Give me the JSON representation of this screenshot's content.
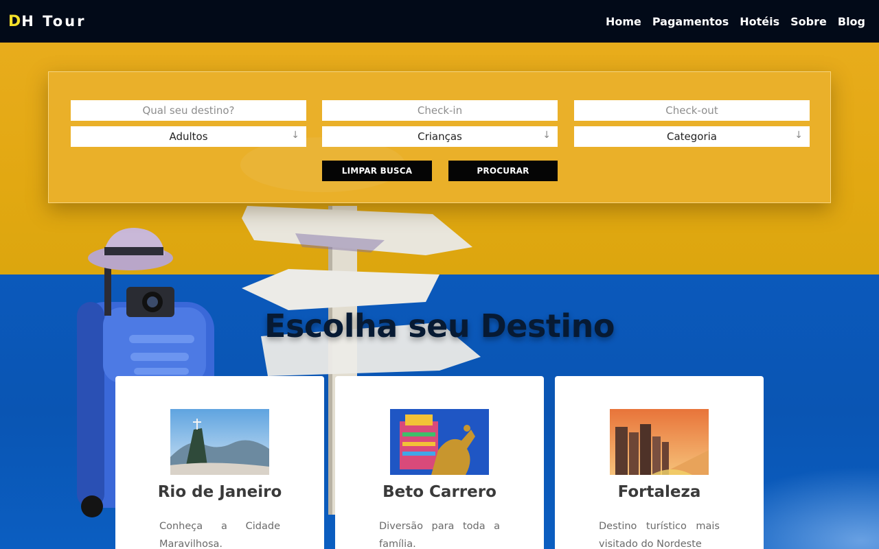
{
  "brand": {
    "logo_initial": "D",
    "logo_rest": "H Tour"
  },
  "nav": {
    "items": [
      {
        "label": "Home"
      },
      {
        "label": "Pagamentos"
      },
      {
        "label": "Hotéis"
      },
      {
        "label": "Sobre"
      },
      {
        "label": "Blog"
      }
    ]
  },
  "search": {
    "destination_placeholder": "Qual seu destino?",
    "checkin_placeholder": "Check-in",
    "checkout_placeholder": "Check-out",
    "adults_label": "Adultos",
    "children_label": "Crianças",
    "category_label": "Categoria",
    "clear_button": "LIMPAR BUSCA",
    "search_button": "PROCURAR"
  },
  "destinations": {
    "title": "Escolha seu Destino",
    "cards": [
      {
        "title": "Rio de Janeiro",
        "description": "Conheça a Cidade Maravilhosa."
      },
      {
        "title": "Beto Carrero",
        "description": "Diversão para toda a família."
      },
      {
        "title": "Fortaleza",
        "description": "Destino turístico mais visitado do Nordeste"
      }
    ]
  },
  "icons": {
    "dropdown": "arrow-down-icon"
  },
  "colors": {
    "nav_bg": "#020a18",
    "logo_accent": "#f5e12a",
    "hero_yellow": "#e5aa18",
    "hero_blue": "#0b59bb",
    "button_bg": "#050505"
  }
}
